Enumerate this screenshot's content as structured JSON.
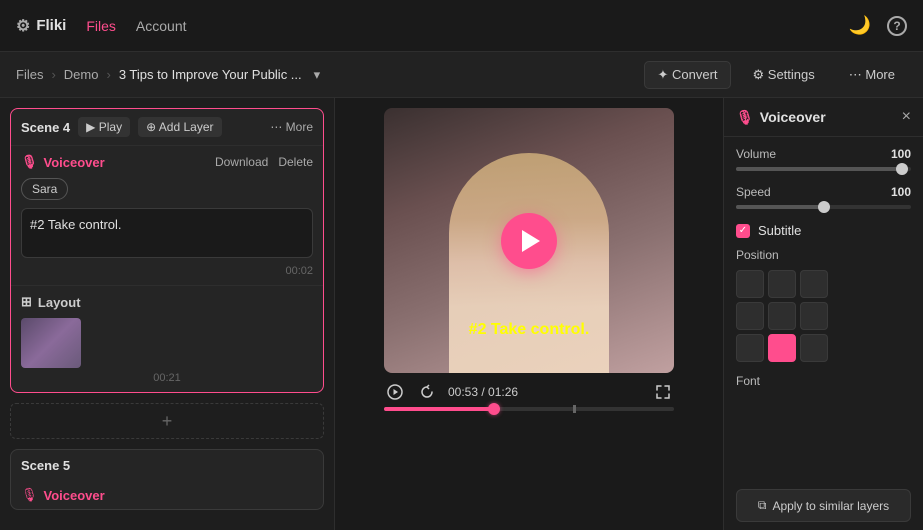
{
  "app": {
    "name": "Fliki",
    "gear_icon": "⚙",
    "moon_icon": "🌙",
    "help_icon": "?",
    "nav_items": [
      {
        "label": "Files",
        "active": true
      },
      {
        "label": "Account",
        "active": false
      }
    ]
  },
  "breadcrumb": {
    "items": [
      "Files",
      "Demo",
      "3 Tips to Improve Your Public ..."
    ],
    "chevron": "▾",
    "convert_label": "✦ Convert",
    "settings_label": "⚙ Settings",
    "more_label": "⋯ More"
  },
  "scene4": {
    "title": "Scene 4",
    "play_label": "▶ Play",
    "add_layer_label": "⊕ Add Layer",
    "more_label": "⋯ More",
    "voiceover": {
      "label": "Voiceover",
      "download": "Download",
      "delete": "Delete",
      "voice_name": "Sara",
      "text": "#2 Take control.",
      "timestamp": "00:02"
    },
    "layout": {
      "label": "Layout",
      "timestamp": "00:21"
    }
  },
  "scene5": {
    "title": "Scene 5",
    "voiceover_label": "Voiceover"
  },
  "video": {
    "subtitle": "#2 Take control.",
    "time_current": "00:53",
    "time_total": "01:26",
    "progress_percent": 38
  },
  "voiceover_panel": {
    "title": "Voiceover",
    "close": "×",
    "volume_label": "Volume",
    "volume_value": "100",
    "volume_percent": 95,
    "speed_label": "Speed",
    "speed_value": "100",
    "speed_percent": 50,
    "subtitle_label": "Subtitle",
    "position_label": "Position",
    "font_label": "Font",
    "apply_label": "Apply to similar layers",
    "position_active": 7
  }
}
